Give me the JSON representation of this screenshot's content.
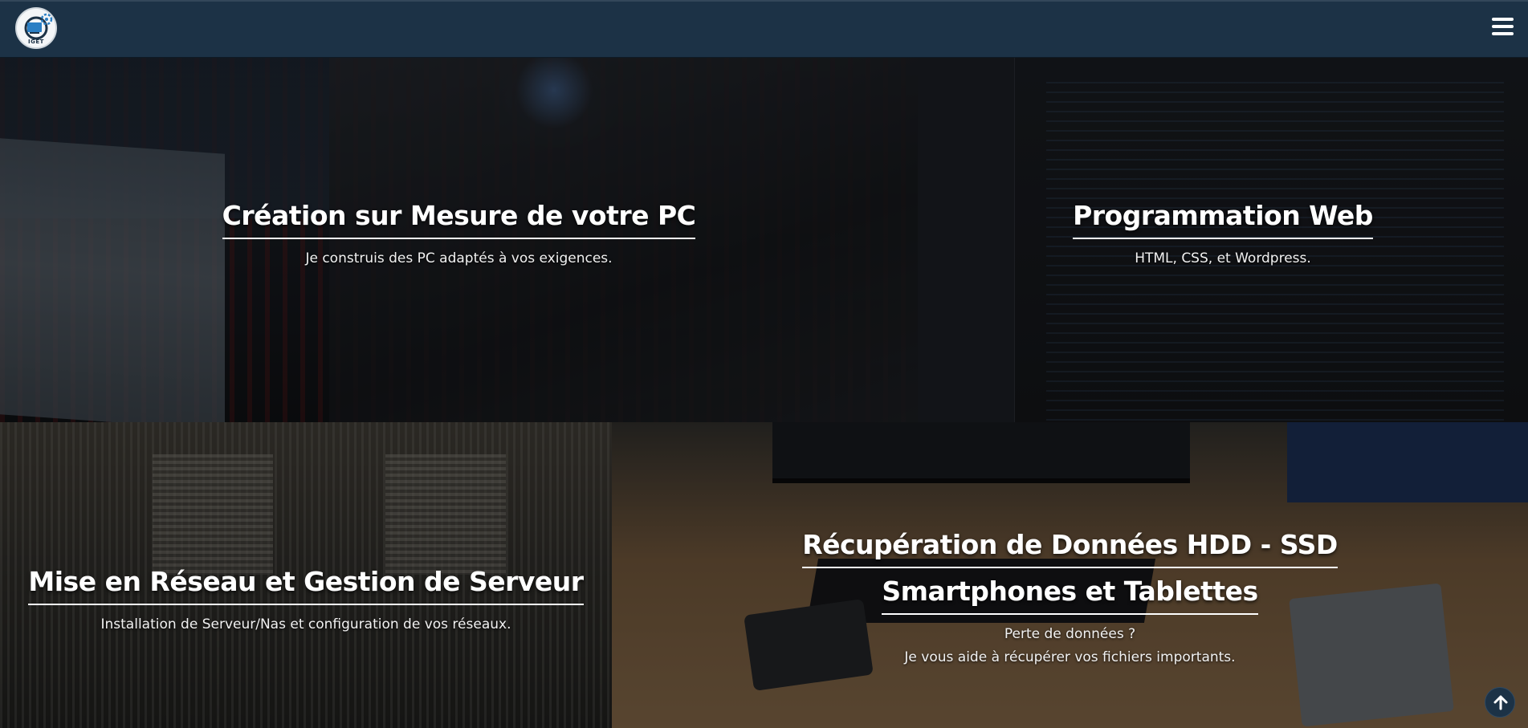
{
  "header": {
    "logo_text": "IGET",
    "logo_icon": "gear-logo",
    "menu_icon": "hamburger-menu-icon"
  },
  "panels": [
    {
      "title": "Création sur Mesure de votre PC",
      "lines": [
        "Je construis des PC adaptés à vos exigences."
      ]
    },
    {
      "title": "Programmation Web",
      "lines": [
        "HTML, CSS, et Wordpress."
      ]
    },
    {
      "title": "Mise en Réseau et Gestion de Serveur",
      "lines": [
        "Installation de Serveur/Nas et configuration de vos réseaux."
      ]
    },
    {
      "title": "Récupération de Données HDD - SSD",
      "title2": "Smartphones et Tablettes",
      "lines": [
        "Perte de données ?",
        "Je vous aide à récupérer vos fichiers importants."
      ]
    }
  ],
  "back_to_top_icon": "arrow-up-icon"
}
